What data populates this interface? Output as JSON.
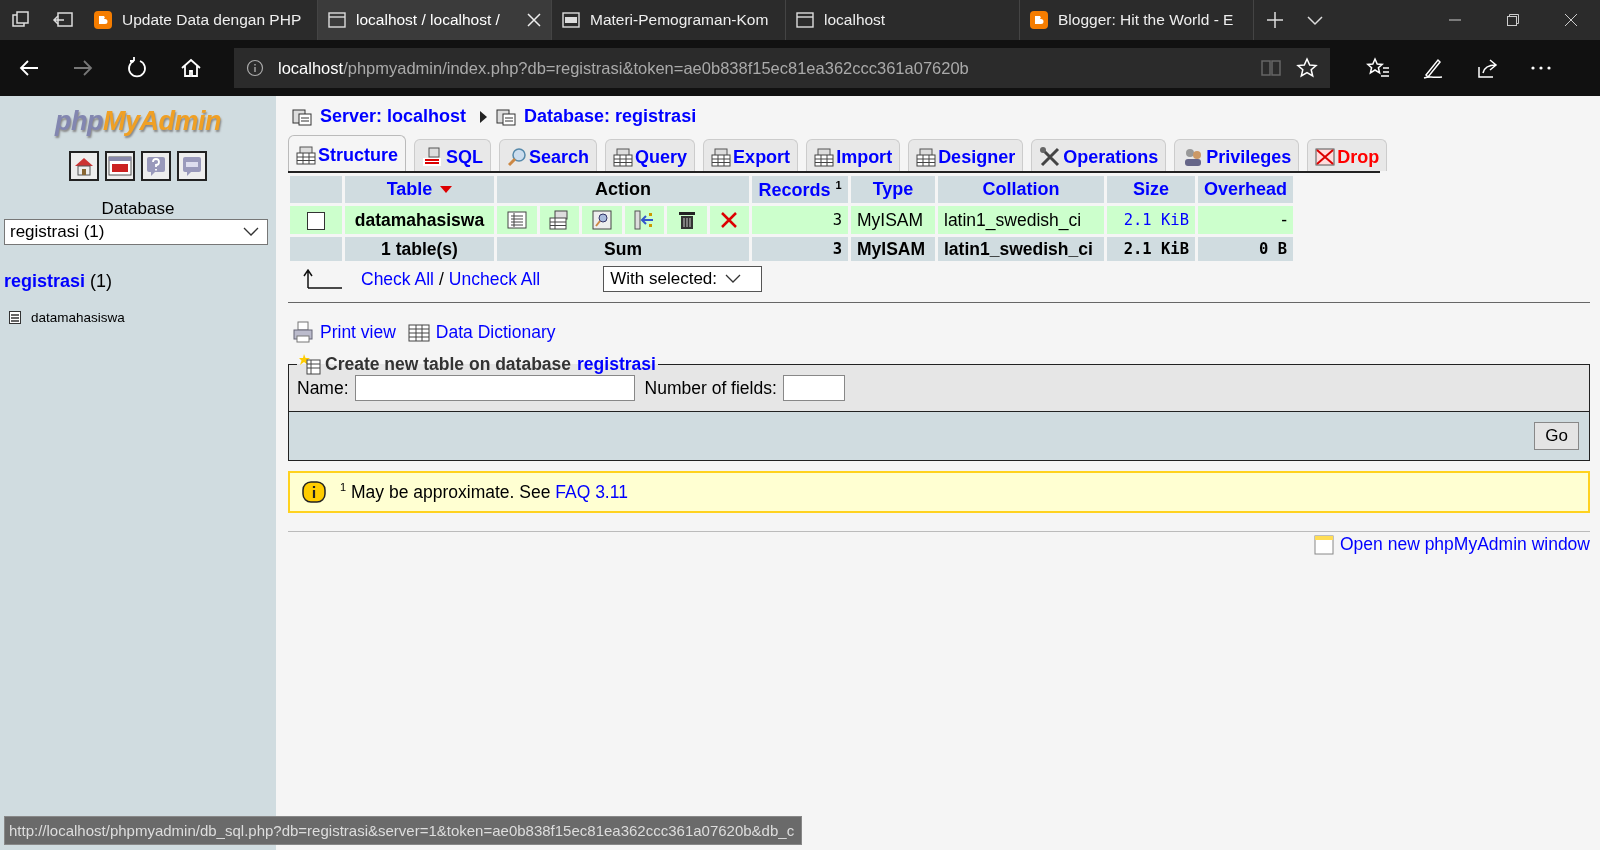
{
  "browser": {
    "tabs": [
      {
        "title": "Update Data dengan PHP",
        "kind": "blogger",
        "selected": false
      },
      {
        "title": "localhost / localhost /",
        "kind": "page",
        "selected": true
      },
      {
        "title": "Materi-Pemograman-Kom",
        "kind": "pdf",
        "selected": false
      },
      {
        "title": "localhost",
        "kind": "page",
        "selected": false
      },
      {
        "title": "Blogger: Hit the World - E",
        "kind": "blogger",
        "selected": false
      }
    ],
    "address": {
      "host": "localhost",
      "path": "/phpmyadmin/index.php?db=registrasi&token=ae0b838f15ec81ea362ccc361a07620b"
    }
  },
  "sidebar": {
    "logo": [
      "php",
      "MyAdmin"
    ],
    "database_label": "Database",
    "database_select": "registrasi (1)",
    "db_link": {
      "name": "registrasi",
      "count": "(1)"
    },
    "tables": [
      "datamahasiswa"
    ]
  },
  "main": {
    "breadcrumb": [
      "Server: localhost",
      "Database: registrasi"
    ],
    "tabs": [
      {
        "label": "Structure",
        "kind": "table",
        "selected": true
      },
      {
        "label": "SQL",
        "kind": "sql",
        "selected": false
      },
      {
        "label": "Search",
        "kind": "search",
        "selected": false
      },
      {
        "label": "Query",
        "kind": "table",
        "selected": false
      },
      {
        "label": "Export",
        "kind": "table",
        "selected": false
      },
      {
        "label": "Import",
        "kind": "table",
        "selected": false
      },
      {
        "label": "Designer",
        "kind": "table",
        "selected": false
      },
      {
        "label": "Operations",
        "kind": "tools",
        "selected": false
      },
      {
        "label": "Privileges",
        "kind": "users",
        "selected": false
      },
      {
        "label": "Drop",
        "kind": "drop",
        "selected": false
      }
    ],
    "table": {
      "columns": [
        {
          "label": "Table",
          "sorted": true
        },
        {
          "label": "Action",
          "sorted": false
        },
        {
          "label": "Records $^{1}$",
          "sorted": false
        },
        {
          "label": "Type",
          "sorted": false
        },
        {
          "label": "Collation",
          "sorted": false
        },
        {
          "label": "Size",
          "sorted": false
        },
        {
          "label": "Overhead",
          "sorted": false
        }
      ],
      "rows": [
        {
          "checked": false,
          "name": "datamahasiswa",
          "records": "3",
          "type": "MyISAM",
          "collation": "latin1_swedish_ci",
          "size": "2.1 KiB",
          "overhead": "-"
        }
      ],
      "footer": {
        "count": "1 table(s)",
        "label": "Sum",
        "records": "3",
        "type": "MyISAM",
        "collation": "latin1_swedish_ci",
        "size": "2.1 KiB",
        "overhead": "0 B"
      }
    },
    "check_all": "Check All",
    "separator": "/",
    "uncheck_all": "Uncheck All",
    "with_selected": "With selected:",
    "links": [
      {
        "label": "Print view",
        "kind": "print"
      },
      {
        "label": "Data Dictionary",
        "kind": "table"
      }
    ],
    "create": {
      "legend": "Create new table on database",
      "db": "registrasi",
      "name_label": "Name:",
      "fields_label": "Number of fields:",
      "button": "Go"
    },
    "notice": {
      "mark": "1",
      "text": "May be approximate. See",
      "link": "FAQ 3.11"
    },
    "new_window": "Open new phpMyAdmin window"
  },
  "status_url": "http://localhost/phpmyadmin/db_sql.php?db=registrasi&server=1&token=ae0b838f15ec81ea362ccc361a07620b&db_c"
}
